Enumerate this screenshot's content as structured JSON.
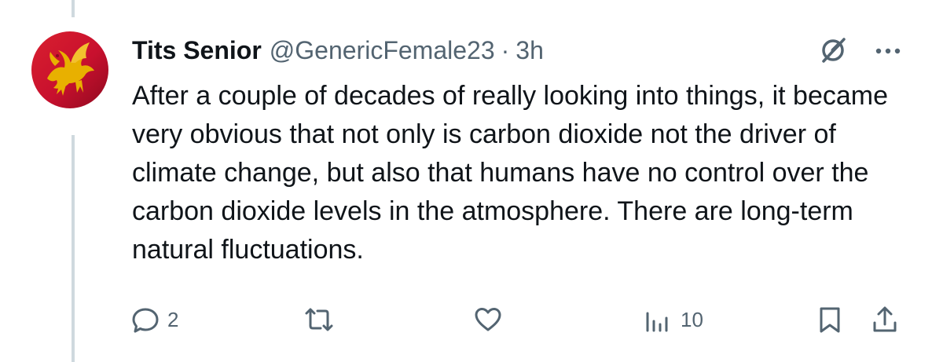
{
  "tweet": {
    "display_name": "Tits Senior",
    "handle": "@GenericFemale23",
    "separator": "·",
    "time": "3h",
    "text": "After a couple of decades of really looking into things, it became very obvious that not only is carbon dioxide not the driver of climate change, but also that humans have no control over the carbon dioxide levels in the atmosphere. There are long-term natural fluctuations."
  },
  "actions": {
    "reply_count": "2",
    "retweet_count": "",
    "like_count": "",
    "views_count": "10"
  },
  "icons": [
    "grok-icon",
    "more-icon",
    "reply-icon",
    "retweet-icon",
    "like-icon",
    "views-icon",
    "bookmark-icon",
    "share-icon"
  ],
  "colors": {
    "text": "#0f1419",
    "secondary": "#536471",
    "thread_line": "#cfd9de",
    "avatar_red": "#c8102e",
    "avatar_gold": "#e8b000"
  }
}
